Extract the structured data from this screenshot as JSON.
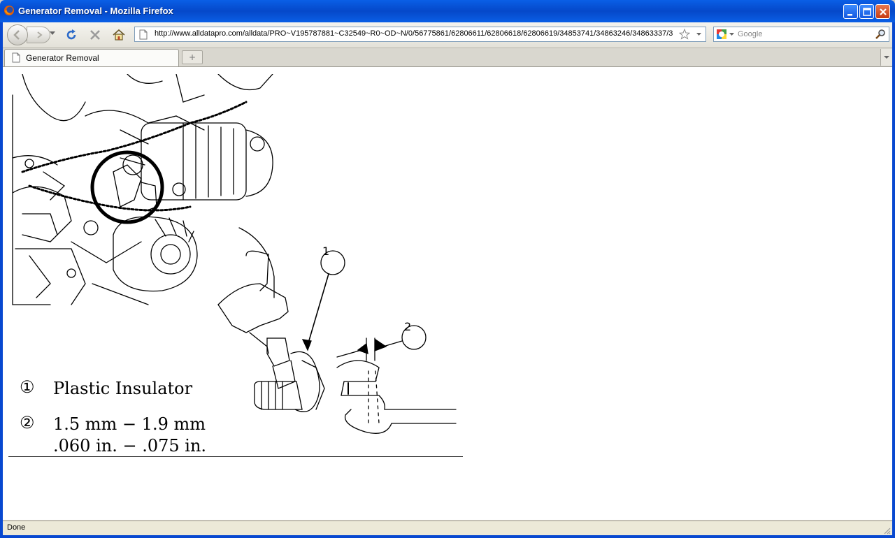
{
  "window": {
    "title": "Generator Removal - Mozilla Firefox",
    "accent": "#0a5fe6"
  },
  "toolbar": {
    "url": "http://www.alldatapro.com/alldata/PRO~V195787881~C32549~R0~OD~N/0/56775861/62806611/62806618/62806619/34853741/34863246/34863337/3",
    "search_placeholder": "Google",
    "icons": [
      "back-icon",
      "forward-icon",
      "reload-icon",
      "stop-icon",
      "home-icon",
      "bookmark-star-icon",
      "search-icon"
    ]
  },
  "tabs": [
    {
      "label": "Generator Removal",
      "active": true
    }
  ],
  "newtab_glyph": "+",
  "diagram": {
    "callouts": [
      "1",
      "2"
    ],
    "legend": [
      {
        "number": "①",
        "lines": [
          "Plastic Insulator"
        ]
      },
      {
        "number": "②",
        "lines": [
          "1.5 mm − 1.9 mm",
          ".060 in. − .075 in."
        ]
      }
    ]
  },
  "statusbar": {
    "status": "Done"
  }
}
